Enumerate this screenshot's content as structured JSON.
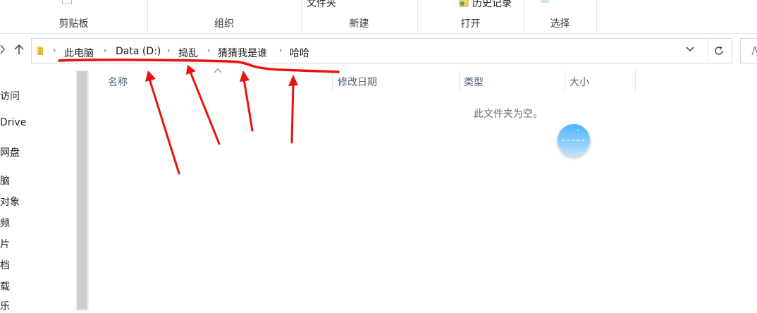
{
  "ribbon": {
    "groups": [
      {
        "label": "剪贴板"
      },
      {
        "label": "组织"
      },
      {
        "label": "新建"
      },
      {
        "label": "打开"
      },
      {
        "label": "选择"
      }
    ],
    "new_folder_label": "文件夹",
    "history_label": "历史记录"
  },
  "address": {
    "crumbs": [
      "此电脑",
      "Data (D:)",
      "捣乱",
      "猜猜我是谁",
      "哈哈"
    ]
  },
  "nav_pane": {
    "items": [
      "访问",
      "Drive",
      "网盘",
      "脑",
      "对象",
      "频",
      "片",
      "档",
      "载",
      "乐"
    ]
  },
  "columns": {
    "name": "名称",
    "date_modified": "修改日期",
    "type": "类型",
    "size": "大小"
  },
  "content": {
    "empty_message": "此文件夹为空。"
  },
  "colors": {
    "annotation": "#e8140c",
    "badge": "#4db2ff"
  }
}
